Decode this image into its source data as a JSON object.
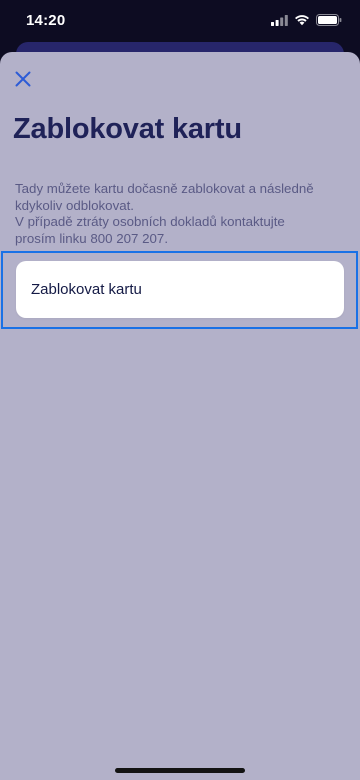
{
  "status_bar": {
    "time": "14:20",
    "icons": [
      "signal-icon",
      "wifi-icon",
      "battery-icon"
    ]
  },
  "sheet": {
    "close_icon": "close-icon",
    "title": "Zablokovat kartu",
    "description_lines": [
      "Tady můžete kartu dočasně zablokovat a následně",
      "kdykoliv odblokovat.",
      "V případě ztráty osobních dokladů kontaktujte",
      "prosím linku 800 207 207."
    ],
    "block_button_label": "Zablokovat kartu"
  },
  "colors": {
    "sheet_background": "#b3b1c9",
    "title": "#1f2258",
    "accent_highlight": "#1971e6",
    "close_icon": "#2d5bd6",
    "underlay_card": "#27266b"
  }
}
